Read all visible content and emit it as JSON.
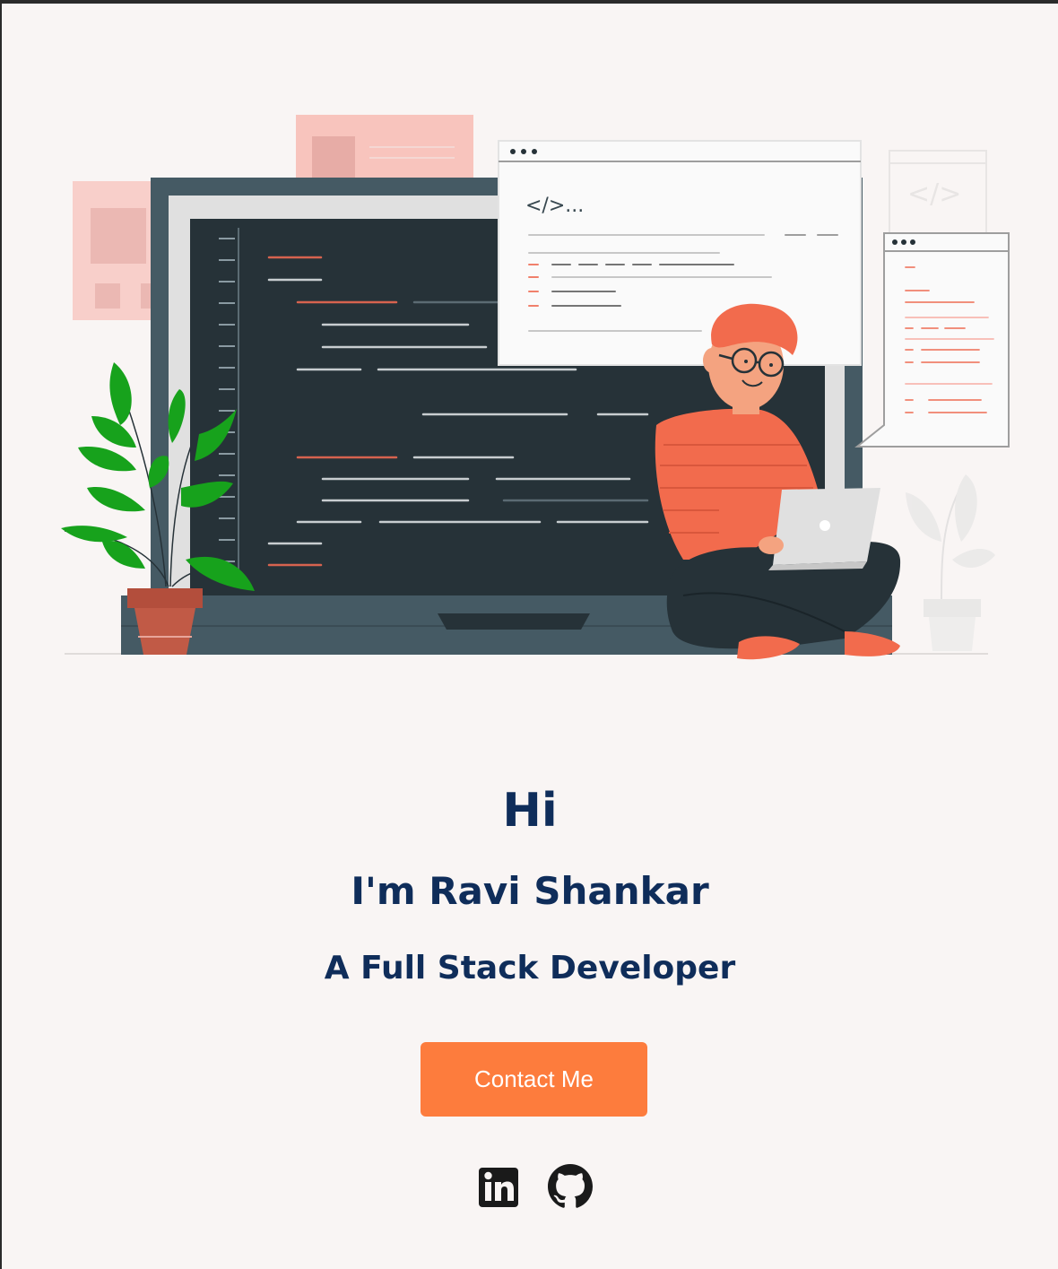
{
  "hero": {
    "greeting": "Hi",
    "name": "I'm Ravi Shankar",
    "role": "A Full Stack Developer",
    "contact_label": "Contact Me"
  },
  "illustration": {
    "code_label": "</>..."
  },
  "social": [
    {
      "icon": "linkedin-icon"
    },
    {
      "icon": "github-icon"
    }
  ],
  "colors": {
    "background": "#f9f5f4",
    "heading": "#0f2d5a",
    "accent": "#fd7c3d",
    "screen": "#263238",
    "laptop_frame": "#455a64",
    "skin": "#f4a380",
    "shirt": "#f26b4d",
    "plant": "#17a21c"
  }
}
